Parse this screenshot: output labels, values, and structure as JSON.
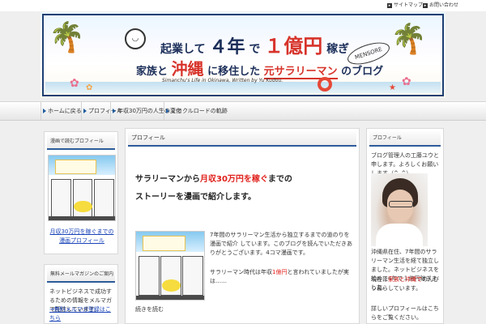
{
  "top_links": [
    "サイトマップ",
    "お問い合わせ"
  ],
  "banner": {
    "line1_a": "起業して",
    "line1_years": "４年",
    "line1_b": "で",
    "line1_amount": "１億円",
    "line1_c": "稼ぎ",
    "line2_a": "家族と",
    "line2_place": "沖縄",
    "line2_b": "に移住した",
    "line2_c": "元サラリーマン",
    "line2_d": "のブログ",
    "stamp": "MENSORE",
    "subtitle": "Simanchu's Life in Okinawa, Written by Yu Kudou.",
    "bubble_icon": "speech-bubble-icon"
  },
  "nav": [
    "ホームに戻る",
    "プロフィール",
    "年収30万円の人生の変化",
    "ミラクルロードの軌跡"
  ],
  "left_sidebar": {
    "panel1_title": "漫画で読むプロフィール",
    "panel1_link": "月収30万円を稼ぐまでの漫画プロフィール",
    "panel2_title": "無料メールマガジンのご案内",
    "panel2_text": "ネットビジネスで成功するための情報をメルマガで配信しています。",
    "panel2_link": "→無料メルマガ登録はこちら"
  },
  "main": {
    "header": "プロフィール",
    "heading_a": "サラリーマンから",
    "heading_red": "月収30万円を稼ぐ",
    "heading_b": "までの",
    "heading_line2": "ストーリーを漫画で紹介します。",
    "para1": "7年間のサラリーマン生活から独立するまでの道のりを 漫画で紹介 しています。このブログを読んでいただきありがとうございます。4コマ漫画です。",
    "para2_a": "サラリーマン時代は年収",
    "para2_red": "1億円",
    "para2_b": "と言われていましたが実は……",
    "footer_text": "続きを読む"
  },
  "right_sidebar": {
    "title": "プロフィール",
    "intro": "ブログ管理人の工藤ユウと申します。よろしくお願いします（^_^）",
    "text1": "沖縄県在住、7年間のサラリーマン生活を経て独立しました。ネットビジネスを始めて4年で１億円稼ぎました。",
    "text2_a": "現在は",
    "text2_red": "家族と沖縄で",
    "text2_b": "のんびり暮らしています。",
    "text3": "詳しいプロフィールはこちらをご覧ください。"
  },
  "colors": {
    "accent": "#2d5b9a",
    "highlight_red": "#e0201b",
    "link": "#1a44b8"
  }
}
